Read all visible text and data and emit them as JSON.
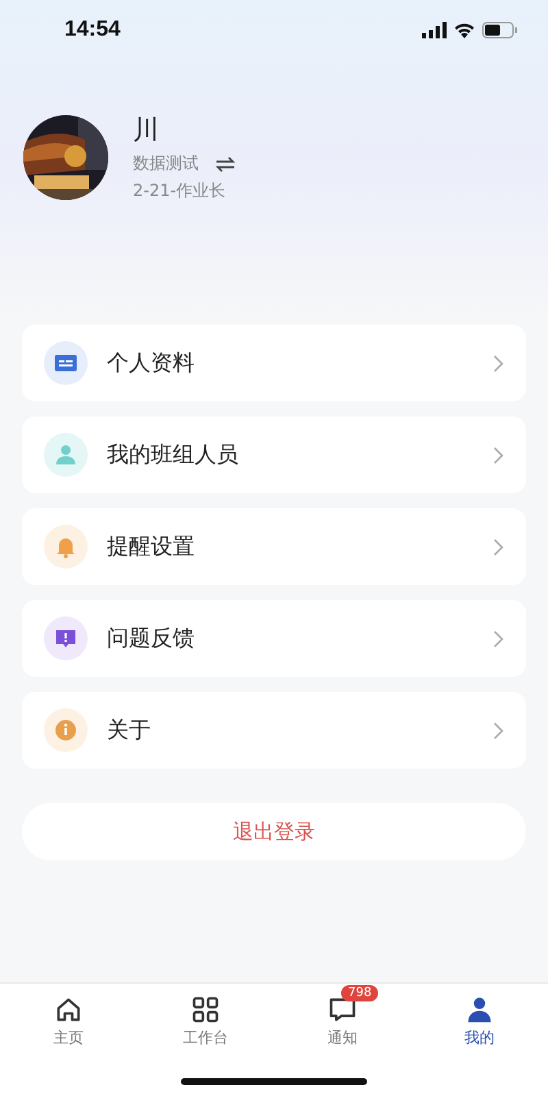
{
  "status_bar": {
    "time": "14:54"
  },
  "profile": {
    "name": "川",
    "team": "数据测试",
    "role": "2-21-作业长"
  },
  "menu": [
    {
      "label": "个人资料",
      "kind": "card"
    },
    {
      "label": "我的班组人员",
      "kind": "person"
    },
    {
      "label": "提醒设置",
      "kind": "bell"
    },
    {
      "label": "问题反馈",
      "kind": "feedback"
    },
    {
      "label": "关于",
      "kind": "info"
    }
  ],
  "logout": "退出登录",
  "tabs": [
    {
      "label": "主页",
      "kind": "home",
      "selected": false
    },
    {
      "label": "工作台",
      "kind": "grid",
      "selected": false
    },
    {
      "label": "通知",
      "kind": "chat",
      "selected": false,
      "badge": "798"
    },
    {
      "label": "我的",
      "kind": "user",
      "selected": true
    }
  ]
}
